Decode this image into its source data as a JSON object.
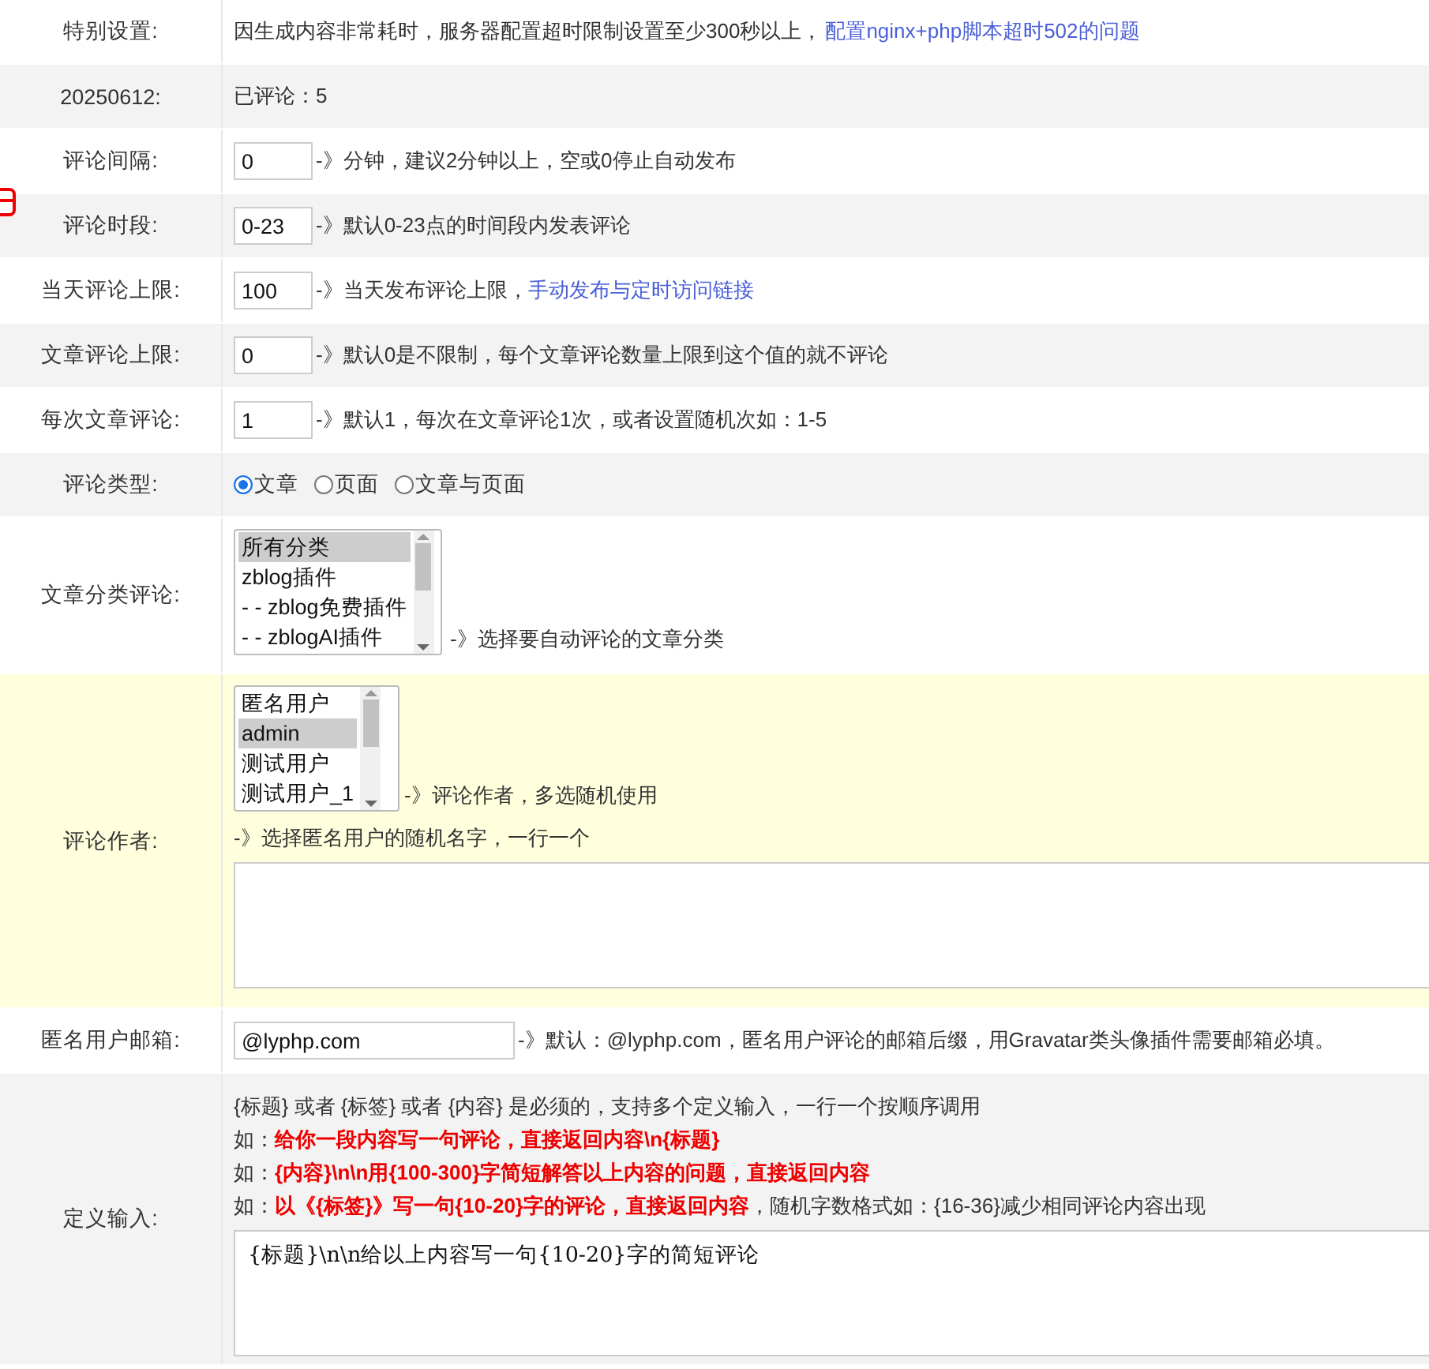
{
  "rows": [
    {
      "kind": "note",
      "label": "特别设置:",
      "highlighted": false,
      "note": "因生成内容非常耗时，服务器配置超时限制设置至少300秒以上，",
      "link": "配置nginx+php脚本超时502的问题"
    },
    {
      "kind": "note",
      "label": "20250612:",
      "highlighted": false,
      "note": "已评论：5"
    },
    {
      "kind": "input",
      "label": "评论间隔:",
      "highlighted": false,
      "value": "0",
      "note": "-》分钟，建议2分钟以上，空或0停止自动发布"
    },
    {
      "kind": "input",
      "label": "评论时段:",
      "highlighted": false,
      "value": "0-23",
      "note": "-》默认0-23点的时间段内发表评论"
    },
    {
      "kind": "input",
      "label": "当天评论上限:",
      "highlighted": false,
      "value": "100",
      "note": "-》当天发布评论上限，",
      "link": "手动发布与定时访问链接"
    },
    {
      "kind": "input",
      "label": "文章评论上限:",
      "highlighted": false,
      "value": "0",
      "note": "-》默认0是不限制，每个文章评论数量上限到这个值的就不评论"
    },
    {
      "kind": "input",
      "label": "每次文章评论:",
      "highlighted": false,
      "value": "1",
      "note": "-》默认1，每次在文章评论1次，或者设置随机次如：1-5"
    },
    {
      "kind": "radio",
      "label": "评论类型:",
      "highlighted": false,
      "options": [
        {
          "label": "文章",
          "selected": true
        },
        {
          "label": "页面",
          "selected": false
        },
        {
          "label": "文章与页面",
          "selected": false
        }
      ]
    },
    {
      "kind": "listbox",
      "label": "文章分类评论:",
      "highlighted": false,
      "note": "-》选择要自动评论的文章分类",
      "options": [
        {
          "label": "所有分类",
          "selected": true
        },
        {
          "label": "zblog插件",
          "selected": false
        },
        {
          "label": "- - zblog免费插件",
          "selected": false
        },
        {
          "label": "- - zblogAI插件",
          "selected": false
        }
      ]
    },
    {
      "kind": "author",
      "label": "评论作者:",
      "highlighted": true,
      "note": "-》评论作者，多选随机使用",
      "hint": "-》选择匿名用户的随机名字，一行一个",
      "options": [
        {
          "label": "匿名用户",
          "selected": false
        },
        {
          "label": "admin",
          "selected": true
        },
        {
          "label": "测试用户",
          "selected": false
        },
        {
          "label": "测试用户_1",
          "selected": false
        }
      ]
    },
    {
      "kind": "email",
      "label": "匿名用户邮箱:",
      "highlighted": false,
      "value": "@lyphp.com",
      "note": "-》默认：@lyphp.com，匿名用户评论的邮箱后缀，用Gravatar类头像插件需要邮箱必填。"
    },
    {
      "kind": "define",
      "label": "定义输入:",
      "highlighted": false,
      "lines": [
        "{标题} 或者 {标签} 或者 {内容} 是必须的，支持多个定义输入，一行一个按顺序调用",
        "如：**给你一段内容写一句评论，直接返回内容\\n{标题}**",
        "如：**{内容}\\n\\n用{100-300}字简短解答以上内容的问题，直接返回内容**",
        "如：**以《{标签}》写一句{10-20}字的评论，直接返回内容**，随机字数格式如：{16-36}减少相同评论内容出现"
      ],
      "value": "{标题}\\n\\n给以上内容写一句{10-20}字的简短评论"
    }
  ]
}
